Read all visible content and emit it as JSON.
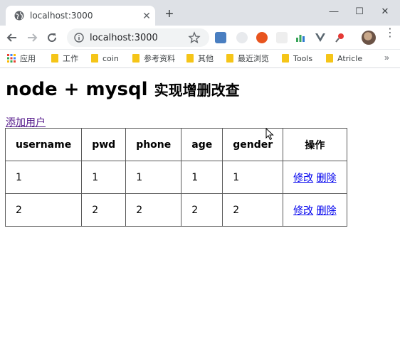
{
  "browser": {
    "tab_title": "localhost:3000",
    "new_tab_label": "+",
    "address": "localhost:3000",
    "window_controls": [
      "—",
      "☐",
      "✕"
    ],
    "bookmarks": [
      "应用",
      "工作",
      "coin",
      "参考资料",
      "其他",
      "最近浏览",
      "Tools",
      "Atricle"
    ],
    "bookmarks_overflow": "»"
  },
  "page": {
    "title_en": "node + mysql",
    "title_cn": "实现增删改查",
    "add_link": "添加用户"
  },
  "table": {
    "headers": [
      "username",
      "pwd",
      "phone",
      "age",
      "gender",
      "操作"
    ],
    "rows": [
      {
        "username": "1",
        "pwd": "1",
        "phone": "1",
        "age": "1",
        "gender": "1",
        "edit": "修改",
        "delete": "删除"
      },
      {
        "username": "2",
        "pwd": "2",
        "phone": "2",
        "age": "2",
        "gender": "2",
        "edit": "修改",
        "delete": "删除"
      }
    ]
  },
  "colors": {
    "tabstrip_bg": "#dee1e6",
    "link": "#0000ee",
    "visited_link": "#551a8b",
    "folder": "#f5c518"
  }
}
